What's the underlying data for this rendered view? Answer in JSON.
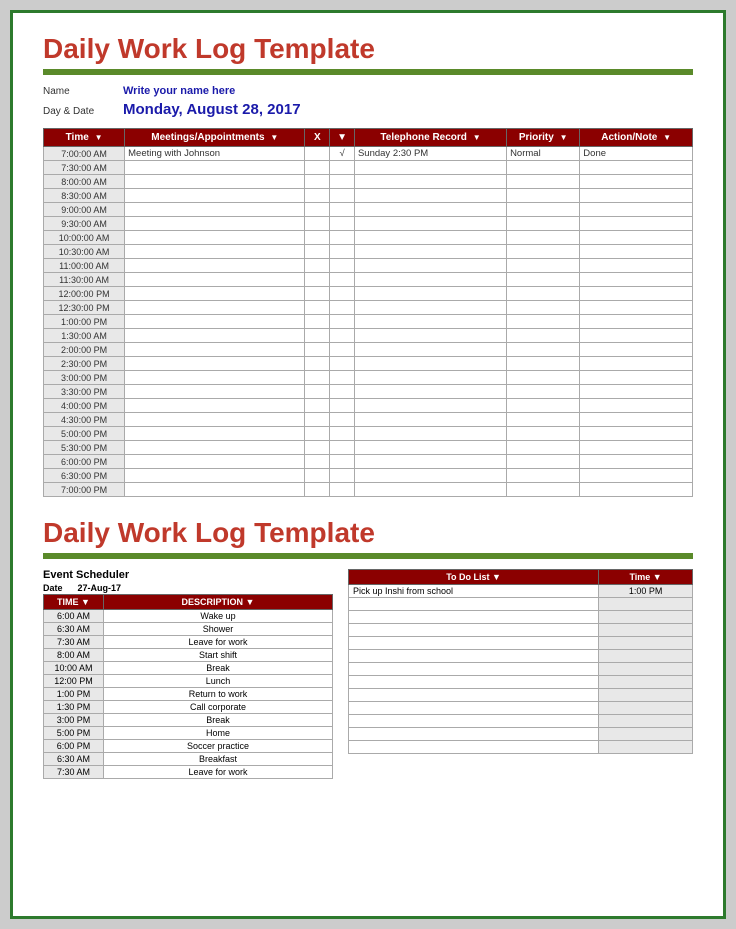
{
  "section1": {
    "title": "Daily Work Log Template",
    "name_label": "Name",
    "name_value": "Write your name here",
    "date_label": "Day & Date",
    "date_value": "Monday, August 28, 2017",
    "table": {
      "headers": [
        "Time",
        "Meetings/Appointments",
        "X",
        "",
        "Telephone Record",
        "Priority",
        "Action/Note"
      ],
      "rows": [
        {
          "time": "7:00:00 AM",
          "meeting": "Meeting with Johnson",
          "x": "",
          "check": "√",
          "tel": "Sunday 2:30 PM",
          "priority": "Normal",
          "action": "Done"
        },
        {
          "time": "7:30:00 AM",
          "meeting": "",
          "x": "",
          "check": "",
          "tel": "",
          "priority": "",
          "action": ""
        },
        {
          "time": "8:00:00 AM",
          "meeting": "",
          "x": "",
          "check": "",
          "tel": "",
          "priority": "",
          "action": ""
        },
        {
          "time": "8:30:00 AM",
          "meeting": "",
          "x": "",
          "check": "",
          "tel": "",
          "priority": "",
          "action": ""
        },
        {
          "time": "9:00:00 AM",
          "meeting": "",
          "x": "",
          "check": "",
          "tel": "",
          "priority": "",
          "action": ""
        },
        {
          "time": "9:30:00 AM",
          "meeting": "",
          "x": "",
          "check": "",
          "tel": "",
          "priority": "",
          "action": ""
        },
        {
          "time": "10:00:00 AM",
          "meeting": "",
          "x": "",
          "check": "",
          "tel": "",
          "priority": "",
          "action": ""
        },
        {
          "time": "10:30:00 AM",
          "meeting": "",
          "x": "",
          "check": "",
          "tel": "",
          "priority": "",
          "action": ""
        },
        {
          "time": "11:00:00 AM",
          "meeting": "",
          "x": "",
          "check": "",
          "tel": "",
          "priority": "",
          "action": ""
        },
        {
          "time": "11:30:00 AM",
          "meeting": "",
          "x": "",
          "check": "",
          "tel": "",
          "priority": "",
          "action": ""
        },
        {
          "time": "12:00:00 PM",
          "meeting": "",
          "x": "",
          "check": "",
          "tel": "",
          "priority": "",
          "action": ""
        },
        {
          "time": "12:30:00 PM",
          "meeting": "",
          "x": "",
          "check": "",
          "tel": "",
          "priority": "",
          "action": ""
        },
        {
          "time": "1:00:00 PM",
          "meeting": "",
          "x": "",
          "check": "",
          "tel": "",
          "priority": "",
          "action": ""
        },
        {
          "time": "1:30:00 AM",
          "meeting": "",
          "x": "",
          "check": "",
          "tel": "",
          "priority": "",
          "action": ""
        },
        {
          "time": "2:00:00 PM",
          "meeting": "",
          "x": "",
          "check": "",
          "tel": "",
          "priority": "",
          "action": ""
        },
        {
          "time": "2:30:00 PM",
          "meeting": "",
          "x": "",
          "check": "",
          "tel": "",
          "priority": "",
          "action": ""
        },
        {
          "time": "3:00:00 PM",
          "meeting": "",
          "x": "",
          "check": "",
          "tel": "",
          "priority": "",
          "action": ""
        },
        {
          "time": "3:30:00 PM",
          "meeting": "",
          "x": "",
          "check": "",
          "tel": "",
          "priority": "",
          "action": ""
        },
        {
          "time": "4:00:00 PM",
          "meeting": "",
          "x": "",
          "check": "",
          "tel": "",
          "priority": "",
          "action": ""
        },
        {
          "time": "4:30:00 PM",
          "meeting": "",
          "x": "",
          "check": "",
          "tel": "",
          "priority": "",
          "action": ""
        },
        {
          "time": "5:00:00 PM",
          "meeting": "",
          "x": "",
          "check": "",
          "tel": "",
          "priority": "",
          "action": ""
        },
        {
          "time": "5:30:00 PM",
          "meeting": "",
          "x": "",
          "check": "",
          "tel": "",
          "priority": "",
          "action": ""
        },
        {
          "time": "6:00:00 PM",
          "meeting": "",
          "x": "",
          "check": "",
          "tel": "",
          "priority": "",
          "action": ""
        },
        {
          "time": "6:30:00 PM",
          "meeting": "",
          "x": "",
          "check": "",
          "tel": "",
          "priority": "",
          "action": ""
        },
        {
          "time": "7:00:00 PM",
          "meeting": "",
          "x": "",
          "check": "",
          "tel": "",
          "priority": "",
          "action": ""
        }
      ]
    }
  },
  "section2": {
    "title": "Daily Work Log Template",
    "event_scheduler": {
      "title": "Event Scheduler",
      "date_label": "Date",
      "date_value": "27-Aug-17",
      "time_header": "TIME",
      "desc_header": "DESCRIPTION",
      "rows": [
        {
          "time": "6:00 AM",
          "desc": "Wake up"
        },
        {
          "time": "6:30 AM",
          "desc": "Shower"
        },
        {
          "time": "7:30 AM",
          "desc": "Leave for work"
        },
        {
          "time": "8:00 AM",
          "desc": "Start shift"
        },
        {
          "time": "10:00 AM",
          "desc": "Break"
        },
        {
          "time": "12:00 PM",
          "desc": "Lunch"
        },
        {
          "time": "1:00 PM",
          "desc": "Return to work"
        },
        {
          "time": "1:30 PM",
          "desc": "Call corporate"
        },
        {
          "time": "3:00 PM",
          "desc": "Break"
        },
        {
          "time": "5:00 PM",
          "desc": "Home"
        },
        {
          "time": "6:00 PM",
          "desc": "Soccer practice"
        },
        {
          "time": "6:30 AM",
          "desc": "Breakfast"
        },
        {
          "time": "7:30 AM",
          "desc": "Leave for work"
        }
      ]
    },
    "todo": {
      "task_header": "To Do List",
      "time_header": "Time",
      "rows": [
        {
          "task": "Pick up Inshi from school",
          "time": "1:00 PM"
        },
        {
          "task": "",
          "time": ""
        },
        {
          "task": "",
          "time": ""
        },
        {
          "task": "",
          "time": ""
        },
        {
          "task": "",
          "time": ""
        },
        {
          "task": "",
          "time": ""
        },
        {
          "task": "",
          "time": ""
        },
        {
          "task": "",
          "time": ""
        },
        {
          "task": "",
          "time": ""
        },
        {
          "task": "",
          "time": ""
        },
        {
          "task": "",
          "time": ""
        },
        {
          "task": "",
          "time": ""
        },
        {
          "task": "",
          "time": ""
        }
      ]
    }
  }
}
